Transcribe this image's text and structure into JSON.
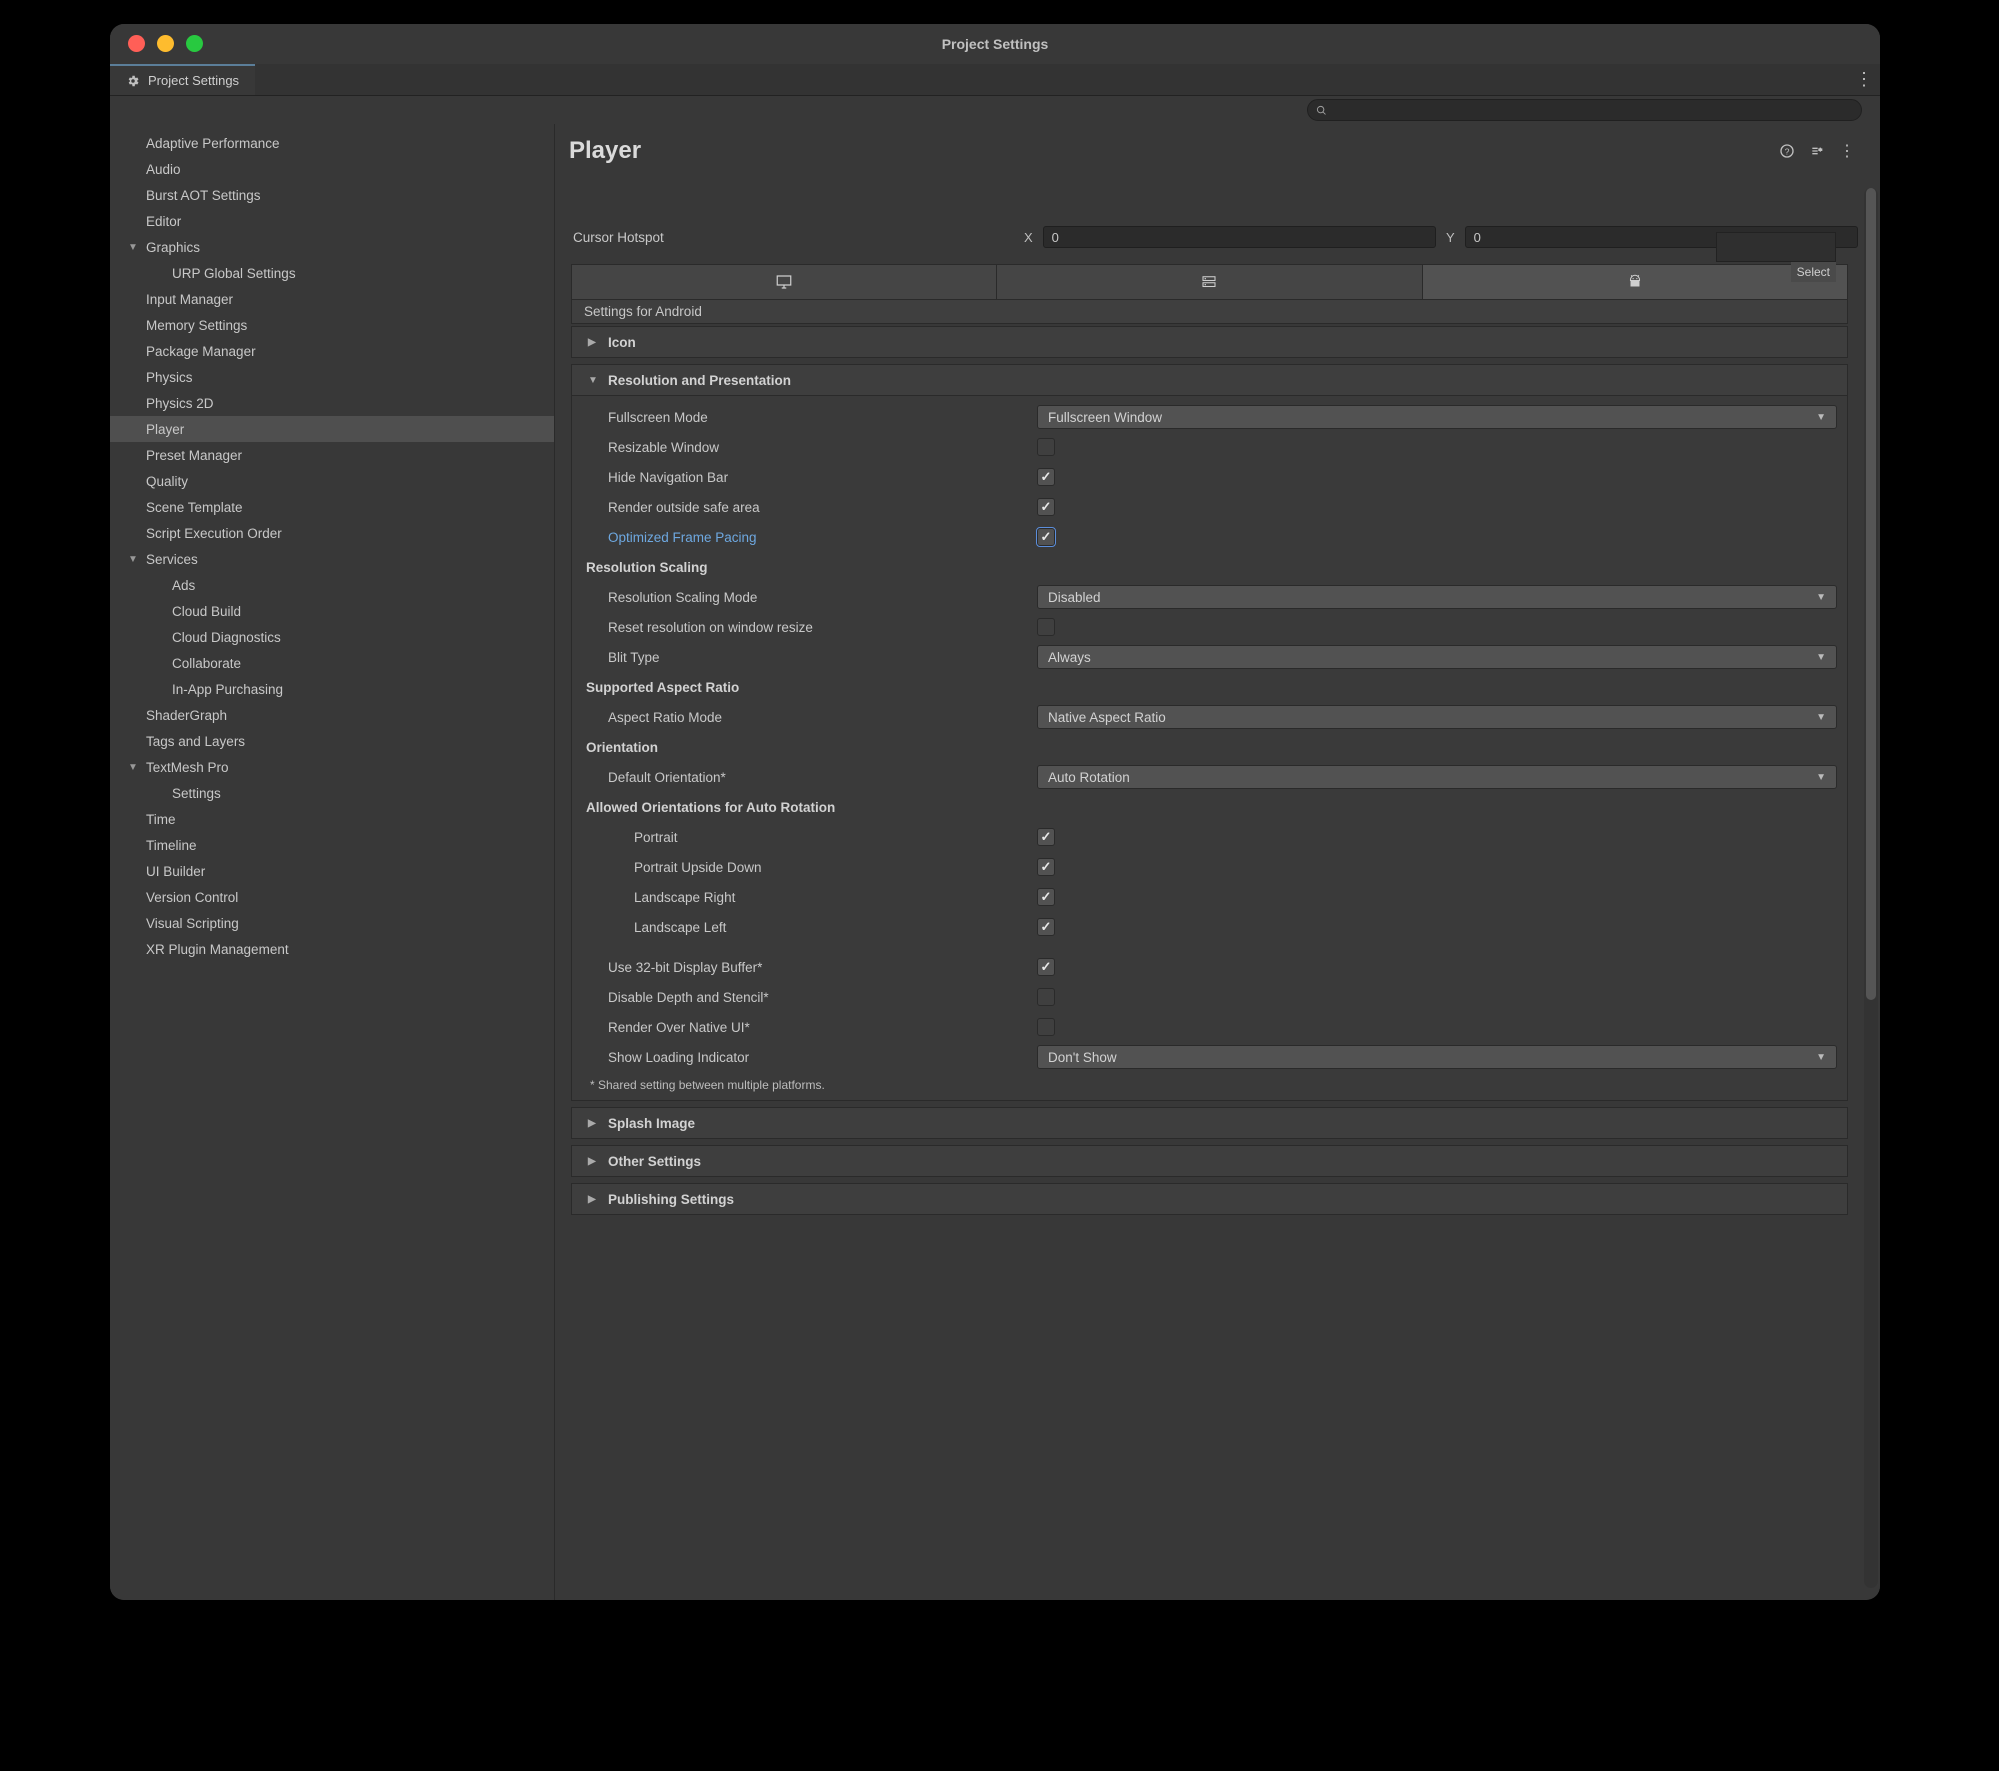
{
  "window": {
    "title": "Project Settings",
    "tab_label": "Project Settings"
  },
  "content": {
    "title": "Player",
    "select_label": "Select",
    "cursor_hotspot_label": "Cursor Hotspot",
    "cursor_x_label": "X",
    "cursor_x_value": "0",
    "cursor_y_label": "Y",
    "cursor_y_value": "0",
    "platform_banner": "Settings for Android"
  },
  "sidebar": {
    "items": [
      {
        "label": "Adaptive Performance",
        "indent": 0
      },
      {
        "label": "Audio",
        "indent": 0
      },
      {
        "label": "Burst AOT Settings",
        "indent": 0
      },
      {
        "label": "Editor",
        "indent": 0
      },
      {
        "label": "Graphics",
        "indent": 0,
        "expanded": true
      },
      {
        "label": "URP Global Settings",
        "indent": 1
      },
      {
        "label": "Input Manager",
        "indent": 0
      },
      {
        "label": "Memory Settings",
        "indent": 0
      },
      {
        "label": "Package Manager",
        "indent": 0
      },
      {
        "label": "Physics",
        "indent": 0
      },
      {
        "label": "Physics 2D",
        "indent": 0
      },
      {
        "label": "Player",
        "indent": 0,
        "selected": true
      },
      {
        "label": "Preset Manager",
        "indent": 0
      },
      {
        "label": "Quality",
        "indent": 0
      },
      {
        "label": "Scene Template",
        "indent": 0
      },
      {
        "label": "Script Execution Order",
        "indent": 0
      },
      {
        "label": "Services",
        "indent": 0,
        "expanded": true
      },
      {
        "label": "Ads",
        "indent": 1
      },
      {
        "label": "Cloud Build",
        "indent": 1
      },
      {
        "label": "Cloud Diagnostics",
        "indent": 1
      },
      {
        "label": "Collaborate",
        "indent": 1
      },
      {
        "label": "In-App Purchasing",
        "indent": 1
      },
      {
        "label": "ShaderGraph",
        "indent": 0
      },
      {
        "label": "Tags and Layers",
        "indent": 0
      },
      {
        "label": "TextMesh Pro",
        "indent": 0,
        "expanded": true
      },
      {
        "label": "Settings",
        "indent": 1
      },
      {
        "label": "Time",
        "indent": 0
      },
      {
        "label": "Timeline",
        "indent": 0
      },
      {
        "label": "UI Builder",
        "indent": 0
      },
      {
        "label": "Version Control",
        "indent": 0
      },
      {
        "label": "Visual Scripting",
        "indent": 0
      },
      {
        "label": "XR Plugin Management",
        "indent": 0
      }
    ]
  },
  "sections": {
    "icon": "Icon",
    "resolution": "Resolution and Presentation",
    "splash": "Splash Image",
    "other": "Other Settings",
    "publishing": "Publishing Settings"
  },
  "resolution": {
    "fullscreen_label": "Fullscreen Mode",
    "fullscreen_value": "Fullscreen Window",
    "resizable_label": "Resizable Window",
    "hide_nav_label": "Hide Navigation Bar",
    "render_safe_label": "Render outside safe area",
    "frame_pacing_label": "Optimized Frame Pacing",
    "scaling_header": "Resolution Scaling",
    "scaling_mode_label": "Resolution Scaling Mode",
    "scaling_mode_value": "Disabled",
    "reset_res_label": "Reset resolution on window resize",
    "blit_label": "Blit Type",
    "blit_value": "Always",
    "aspect_header": "Supported Aspect Ratio",
    "aspect_mode_label": "Aspect Ratio Mode",
    "aspect_mode_value": "Native Aspect Ratio",
    "orientation_header": "Orientation",
    "default_orientation_label": "Default Orientation*",
    "default_orientation_value": "Auto Rotation",
    "allowed_header": "Allowed Orientations for Auto Rotation",
    "portrait_label": "Portrait",
    "portrait_ud_label": "Portrait Upside Down",
    "landscape_r_label": "Landscape Right",
    "landscape_l_label": "Landscape Left",
    "buf32_label": "Use 32-bit Display Buffer*",
    "disable_ds_label": "Disable Depth and Stencil*",
    "render_native_label": "Render Over Native UI*",
    "loading_label": "Show Loading Indicator",
    "loading_value": "Don't Show",
    "footnote": "* Shared setting between multiple platforms."
  }
}
